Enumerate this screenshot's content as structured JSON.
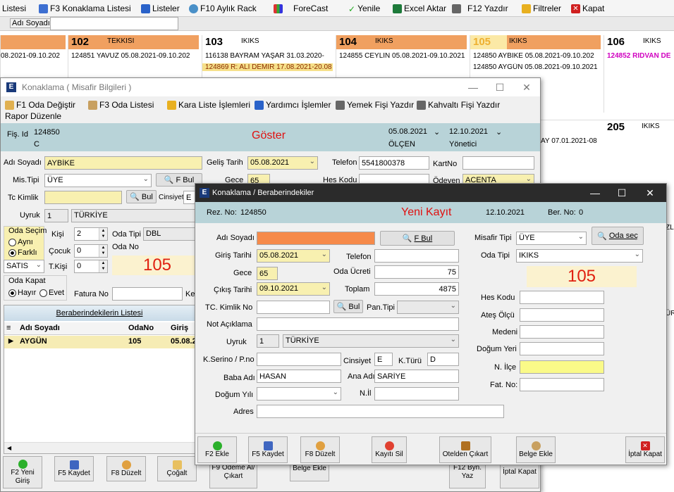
{
  "toolbar": {
    "items": [
      "Listesi",
      "F3 Konaklama Listesi",
      "Listeler",
      "F10 Aylık Rack",
      "ForeCast",
      "Yenile",
      "Excel Aktar",
      "F12 Yazdır",
      "Filtreler",
      "Kapat"
    ]
  },
  "search_bar": {
    "label": "Adı Soyadı",
    "value": ""
  },
  "rooms": [
    {
      "no": "",
      "type": "",
      "color": "#f0a060",
      "lines": [
        "08.2021-09.10.202"
      ]
    },
    {
      "no": "102",
      "type": "TEKKISI",
      "color": "#f0a060",
      "lines": [
        "124851  YAVUZ  05.08.2021-09.10.202"
      ]
    },
    {
      "no": "103",
      "type": "IKIKS",
      "color": "#ffffff",
      "lines": [
        "116138  BAYRAM YAŞAR 31.03.2020-",
        "124869  R: ALİ DEMİR 17.08.2021-20.08"
      ]
    },
    {
      "no": "104",
      "type": "IKIKS",
      "color": "#f0a060",
      "lines": [
        "124855  CEYLİN 05.08.2021-09.10.2021"
      ]
    },
    {
      "no": "105",
      "type": "IKIKS",
      "color": "#f0a060",
      "lines": [
        "124850  AYBİKE  05.08.2021-09.10.202",
        "124850  AYGÜN 05.08.2021-09.10.2021"
      ]
    },
    {
      "no": "106",
      "type": "IKIKS",
      "color": "#ffffff",
      "lines": [
        "124852  RIDVAN DE"
      ]
    }
  ],
  "room205": {
    "no": "205",
    "type": "IKIKS",
    "line": "AY 07.01.2021-08"
  },
  "bg_fragments": {
    "zl": "ZL",
    "ur": "ÜR"
  },
  "guest_window": {
    "title": "Konaklama ( Misafir Bilgileri )",
    "menu": [
      "F1 Oda Değiştir",
      "F3 Oda Listesi",
      "Kara Liste İşlemleri",
      "Yardımcı İşlemler",
      "Yemek Fişi Yazdır",
      "Kahvaltı Fişi Yazdır"
    ],
    "menu2": "Rapor Düzenle",
    "fis_id_label": "Fiş. Id",
    "fis_id": "124850",
    "fis_c": "C",
    "goster": "Göster",
    "date1": "05.08.2021",
    "date2": "12.10.2021",
    "olcen": "ÖLÇEN",
    "yonetici": "Yönetici",
    "adi_soyadi_label": "Adı Soyadı",
    "adi_soyadi": "AYBİKE",
    "gelis_tarih_label": "Geliş Tarih",
    "gelis_tarih": "05.08.2021",
    "telefon_label": "Telefon",
    "telefon": "5541800378",
    "kartno_label": "KartNo",
    "mis_tipi_label": "Mis.Tipi",
    "mis_tipi": "ÜYE",
    "fbul": "F Bul",
    "gece_label": "Gece",
    "gece": "65",
    "hes_kodu_label": "Hes Kodu",
    "odeyen_label": "Ödeyen",
    "odeyen": "ACENTA",
    "tc_label": "Tc Kimlik",
    "bul": "Bul",
    "cinsiyet_label": "Cinsiyet",
    "cinsiyet": "E",
    "uyruk_label": "Uyruk",
    "uyruk_code": "1",
    "uyruk": "TÜRKİYE",
    "oda_secim_label": "Oda Seçim",
    "ayni": "Aynı",
    "farkli": "Farklı",
    "kisi_label": "Kişi",
    "kisi": "2",
    "oda_tipi_label": "Oda Tipi",
    "oda_tipi": "DBL",
    "oda_no_label": "Oda No",
    "cocuk_label": "Çocuk",
    "cocuk": "0",
    "satis": "SATIS",
    "tkisi_label": "T.Kişi",
    "tkisi": "0",
    "room_big": "105",
    "oda_kapat_label": "Oda Kapat",
    "hayir": "Hayır",
    "evet": "Evet",
    "fatura_label": "Fatura No",
    "ke": "Ke",
    "companions_tab": "Beraberindekilerin Listesi",
    "grid_headers": [
      "Adı Soyadı",
      "OdaNo",
      "Giriş"
    ],
    "grid_rows": [
      [
        "AYGÜN",
        "105",
        "05.08.2"
      ]
    ],
    "bottom_buttons": [
      "F2 Yeni Giriş",
      "F5 Kaydet",
      "F8 Düzelt",
      "Çoğalt",
      "F9 Ödeme Al/Çıkart",
      "Belge Ekle",
      "F12 Byn. Yaz",
      "İptal Kapat"
    ]
  },
  "companion_window": {
    "title": "Konaklama / Beraberindekiler",
    "rez_no_label": "Rez. No:",
    "rez_no": "124850",
    "yeni_kayit": "Yeni Kayıt",
    "date": "12.10.2021",
    "ber_no_label": "Ber. No:",
    "ber_no": "0",
    "adi_soyadi_label": "Adı Soyadı",
    "adi_soyadi": "",
    "fbul": "F Bul",
    "misafir_tipi_label": "Misafir Tipi",
    "misafir_tipi": "ÜYE",
    "oda_sec": "Oda seç",
    "giris_tarihi_label": "Giriş Tarihi",
    "giris_tarihi": "05.08.2021",
    "telefon_label": "Telefon",
    "telefon": "",
    "oda_tipi_label": "Oda Tipi",
    "oda_tipi": "IKIKS",
    "gece_label": "Gece",
    "gece": "65",
    "oda_ucreti_label": "Oda Ücreti",
    "oda_ucreti": "75",
    "room_big": "105",
    "cikis_tarihi_label": "Çıkış Tarihi",
    "cikis_tarihi": "09.10.2021",
    "toplam_label": "Toplam",
    "toplam": "4875",
    "hes_kodu_label": "Hes Kodu",
    "tc_label": "TC. Kimlik No",
    "bul": "Bul",
    "pan_tipi_label": "Pan.Tipi",
    "ates_olcu_label": "Ateş Ölçü",
    "not_label": "Not Açıklama",
    "medeni_label": "Medeni",
    "uyruk_label": "Uyruk",
    "uyruk_code": "1",
    "uyruk": "TÜRKİYE",
    "dogum_yeri_label": "Doğum Yeri",
    "kserino_label": "K.Serino / P.no",
    "cinsiyet_label": "Cinsiyet",
    "cinsiyet": "E",
    "kturu_label": "K.Türü",
    "kturu": "D",
    "n_ilce_label": "N. İlçe",
    "baba_adi_label": "Baba Adı",
    "baba_adi": "HASAN",
    "ana_adi_label": "Ana Adı",
    "ana_adi": "SARİYE",
    "fat_no_label": "Fat. No:",
    "dogum_yili_label": "Doğum Yılı",
    "nil_label": "N.İl",
    "adres_label": "Adres",
    "buttons": [
      "F2 Ekle",
      "F5 Kaydet",
      "F8 Düzelt",
      "Kayıtı Sil",
      "Otelden Çıkart",
      "Belge Ekle",
      "İptal Kapat"
    ]
  }
}
